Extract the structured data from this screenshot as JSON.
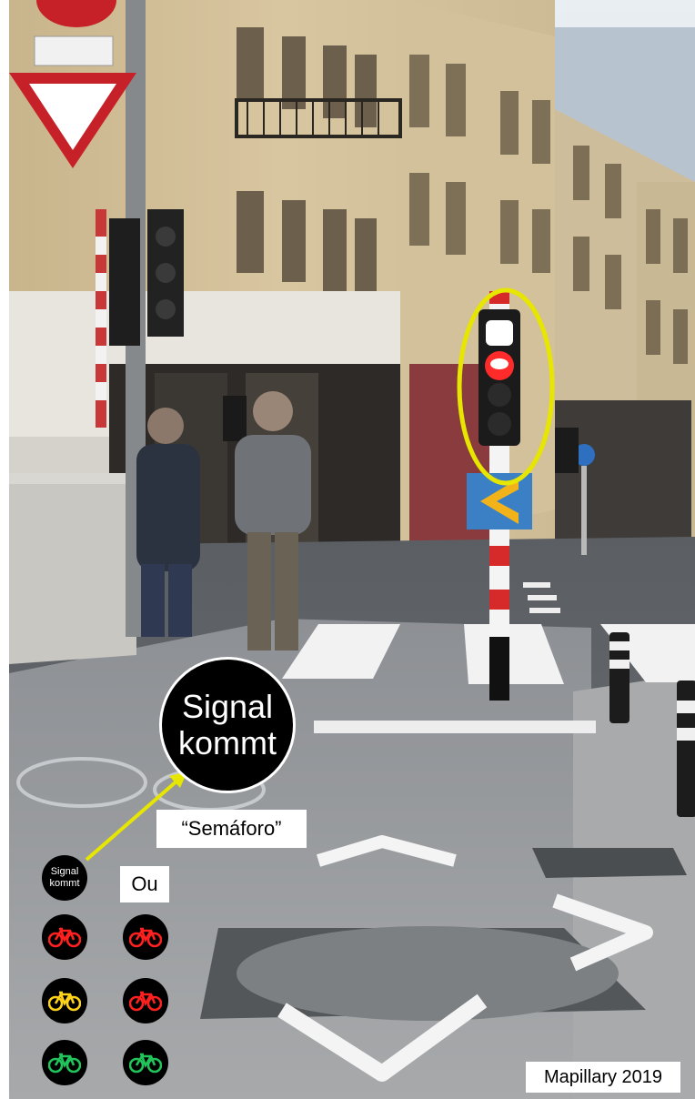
{
  "callout": {
    "main_line1": "Signal",
    "main_line2": "kommt",
    "small_line1": "Signal",
    "small_line2": "kommt",
    "translation": "“Semáforo”",
    "or_label": "Ou"
  },
  "bike_signals": {
    "left_column": [
      "red",
      "yellow",
      "green"
    ],
    "right_column": [
      "red",
      "red",
      "green"
    ]
  },
  "colors": {
    "highlight_ellipse": "#e6e600",
    "pointer_arrow": "#e6e600",
    "signal_red": "#ff2020",
    "signal_yellow": "#ffd21a",
    "signal_green": "#21c45a"
  },
  "credit": "Mapillary 2019"
}
